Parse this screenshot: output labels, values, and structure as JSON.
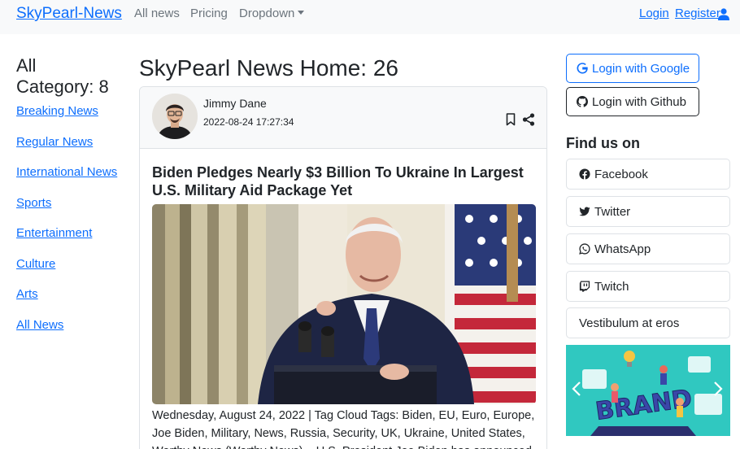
{
  "navbar": {
    "brand": "SkyPearl-News",
    "links": [
      "All news",
      "Pricing",
      "Dropdown"
    ],
    "login": "Login",
    "register": "Register"
  },
  "sidebar": {
    "title_line1": "All",
    "title_line2": "Category: 8",
    "categories": [
      "Breaking News",
      "Regular News",
      "International News",
      "Sports",
      "Entertainment",
      "Culture",
      "Arts",
      "All News"
    ]
  },
  "main": {
    "title": "SkyPearl News Home: 26",
    "article": {
      "author": "Jimmy Dane",
      "date": "2022-08-24 17:27:34",
      "headline": "Biden Pledges Nearly $3 Billion To Ukraine In Largest U.S. Military Aid Package Yet",
      "body": "Wednesday, August 24, 2022 | Tag Cloud Tags: Biden, EU, Euro, Europe, Joe Biden, Military, News, Russia, Security, UK, Ukraine, United States, Worthy News (Worthy News) – U.S. President Joe Biden has announced"
    }
  },
  "right": {
    "google_login": "Login with Google",
    "github_login": "Login with Github",
    "find_us": "Find us on",
    "social": [
      {
        "label": "Facebook",
        "icon": "facebook-icon"
      },
      {
        "label": "Twitter",
        "icon": "twitter-icon"
      },
      {
        "label": "WhatsApp",
        "icon": "whatsapp-icon"
      },
      {
        "label": "Twitch",
        "icon": "twitch-icon"
      },
      {
        "label": "Vestibulum at eros",
        "icon": ""
      }
    ],
    "carousel_text": "BRAND"
  },
  "colors": {
    "link": "#0d6efd",
    "muted": "#6c757d",
    "nav_bg": "#f8f9fa",
    "border": "#dee2e6",
    "carousel_bg": "#30c8c0"
  }
}
